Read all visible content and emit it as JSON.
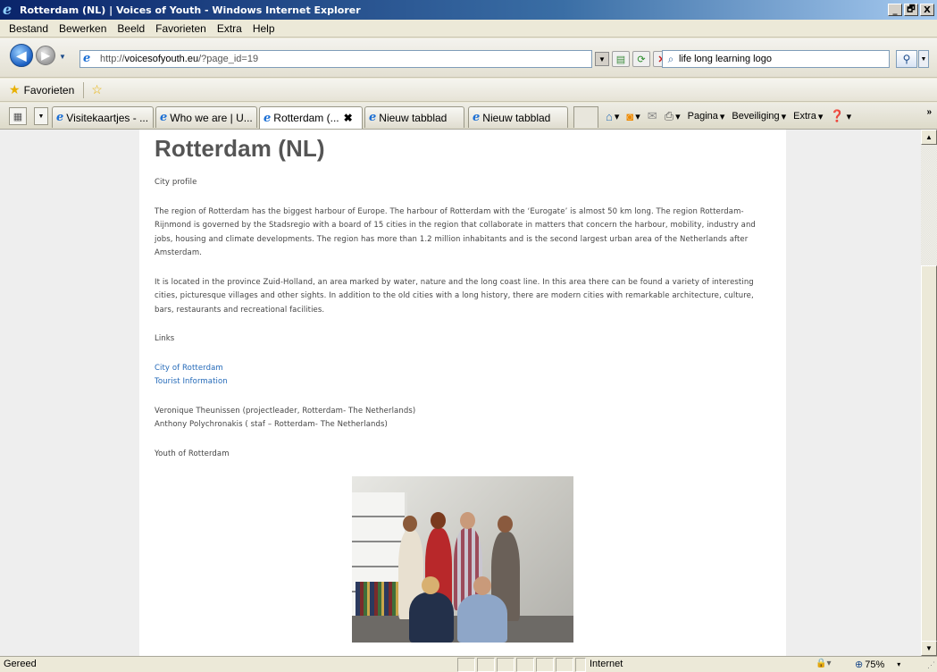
{
  "window": {
    "title": "Rotterdam (NL) | Voices of Youth - Windows Internet Explorer",
    "minimize": "_",
    "maximize": "🗗",
    "close": "X"
  },
  "menu": [
    "Bestand",
    "Bewerken",
    "Beeld",
    "Favorieten",
    "Extra",
    "Help"
  ],
  "address": {
    "url_prefix": "http://",
    "url_host": "voicesofyouth.eu",
    "url_path": "/?page_id=19",
    "search_value": "life long learning logo"
  },
  "favorites": {
    "label": "Favorieten"
  },
  "tabs": [
    {
      "label": "Visitekaartjes - ...",
      "active": false
    },
    {
      "label": "Who we are | U...",
      "active": false
    },
    {
      "label": "Rotterdam (...",
      "active": true
    },
    {
      "label": "Nieuw tabblad",
      "active": false
    },
    {
      "label": "Nieuw tabblad",
      "active": false
    }
  ],
  "command_bar": {
    "page": "Pagina",
    "security": "Beveiliging",
    "extra": "Extra"
  },
  "page": {
    "title": "Rotterdam (NL)",
    "city_profile": "City profile",
    "para1": "The region of Rotterdam has the biggest harbour of Europe. The harbour of Rotterdam with the ‘Eurogate’ is almost 50 km long. The region Rotterdam-Rijnmond is governed by the Stadsregio with a board of 15 cities in the region that collaborate in matters that concern the harbour, mobility, industry and jobs, housing and climate developments. The region has more than 1.2 million inhabitants and is the second largest urban area of the Netherlands after Amsterdam.",
    "para2": "It is located in the province Zuid-Holland, an area marked by water, nature and the long coast line. In this area there can be found a variety of interesting cities, picturesque villages and other sights. In addition to the old cities with a long history, there are modern cities with remarkable architecture, culture, bars, restaurants and recreational facilities.",
    "links_heading": "Links",
    "link1": "City of Rotterdam",
    "link2": "Tourist Information",
    "contact1": "Veronique Theunissen (projectleader, Rotterdam- The Netherlands)",
    "contact2": "Anthony Polychronakis ( staf – Rotterdam- The Netherlands)",
    "youth_heading": "Youth of Rotterdam"
  },
  "status": {
    "text": "Gereed",
    "zone": "Internet",
    "zoom": "75%"
  },
  "colors": {
    "link": "#2369b8",
    "title_text": "#555555"
  }
}
